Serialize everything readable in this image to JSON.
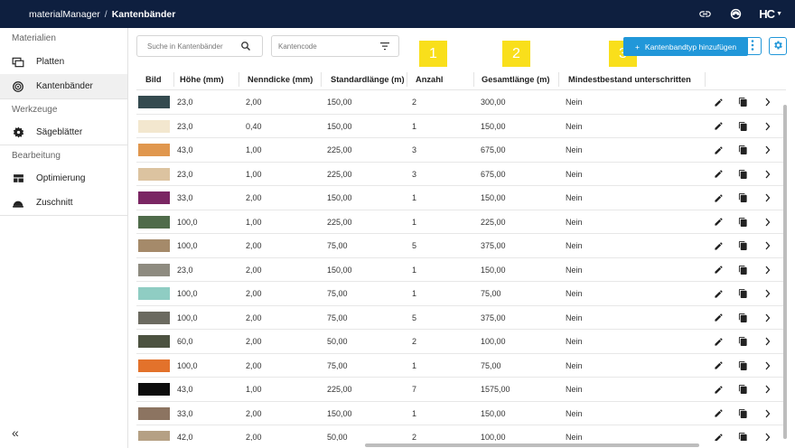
{
  "topbar": {
    "app": "materialManager",
    "separator": "/",
    "page": "Kantenbänder",
    "brand": "HC",
    "icons": [
      "link-icon",
      "support-icon",
      "brand-logo",
      "caret-down-icon"
    ]
  },
  "sidebar": {
    "sections": [
      {
        "title": "Materialien",
        "items": [
          {
            "label": "Platten",
            "icon": "platten-icon"
          },
          {
            "label": "Kantenbänder",
            "icon": "edgeband-roll-icon",
            "active": true
          }
        ]
      },
      {
        "title": "Werkzeuge",
        "items": [
          {
            "label": "Sägeblätter",
            "icon": "saw-blade-icon"
          }
        ]
      },
      {
        "title": "Bearbeitung",
        "items": [
          {
            "label": "Optimierung",
            "icon": "optimization-icon"
          },
          {
            "label": "Zuschnitt",
            "icon": "cutting-icon"
          }
        ]
      }
    ],
    "collapse": "«"
  },
  "toolbar": {
    "search_placeholder": "Suche in Kantenbänder",
    "filter_placeholder": "Kantencode",
    "add_label": "Kantenbandtyp hinzufügen",
    "add_plus": "+"
  },
  "markers": [
    "1",
    "2",
    "3"
  ],
  "colors": {
    "topbar": "#0e1f3f",
    "accent": "#2197d9",
    "marker": "#f9df1b"
  },
  "table": {
    "headers": [
      "Bild",
      "Höhe (mm)",
      "Nenndicke (mm)",
      "Standardlänge (m)",
      "Anzahl",
      "Gesamtlänge (m)",
      "Mindestbestand unterschritten"
    ],
    "rows": [
      {
        "color": "#344a4f",
        "hoehe": "23,0",
        "dicke": "2,00",
        "laenge": "150,00",
        "anzahl": "2",
        "gesamt": "300,00",
        "mindest": "Nein"
      },
      {
        "color": "#f3e7cf",
        "hoehe": "23,0",
        "dicke": "0,40",
        "laenge": "150,00",
        "anzahl": "1",
        "gesamt": "150,00",
        "mindest": "Nein"
      },
      {
        "color": "#e0974e",
        "hoehe": "43,0",
        "dicke": "1,00",
        "laenge": "225,00",
        "anzahl": "3",
        "gesamt": "675,00",
        "mindest": "Nein"
      },
      {
        "color": "#dcc3a0",
        "hoehe": "23,0",
        "dicke": "1,00",
        "laenge": "225,00",
        "anzahl": "3",
        "gesamt": "675,00",
        "mindest": "Nein"
      },
      {
        "color": "#7a2663",
        "hoehe": "33,0",
        "dicke": "2,00",
        "laenge": "150,00",
        "anzahl": "1",
        "gesamt": "150,00",
        "mindest": "Nein"
      },
      {
        "color": "#4f6b4a",
        "hoehe": "100,0",
        "dicke": "1,00",
        "laenge": "225,00",
        "anzahl": "1",
        "gesamt": "225,00",
        "mindest": "Nein"
      },
      {
        "color": "#a58a6a",
        "hoehe": "100,0",
        "dicke": "2,00",
        "laenge": "75,00",
        "anzahl": "5",
        "gesamt": "375,00",
        "mindest": "Nein"
      },
      {
        "color": "#8e8b80",
        "hoehe": "23,0",
        "dicke": "2,00",
        "laenge": "150,00",
        "anzahl": "1",
        "gesamt": "150,00",
        "mindest": "Nein"
      },
      {
        "color": "#8fcdc3",
        "hoehe": "100,0",
        "dicke": "2,00",
        "laenge": "75,00",
        "anzahl": "1",
        "gesamt": "75,00",
        "mindest": "Nein"
      },
      {
        "color": "#6b6a60",
        "hoehe": "100,0",
        "dicke": "2,00",
        "laenge": "75,00",
        "anzahl": "5",
        "gesamt": "375,00",
        "mindest": "Nein"
      },
      {
        "color": "#4c5240",
        "hoehe": "60,0",
        "dicke": "2,00",
        "laenge": "50,00",
        "anzahl": "2",
        "gesamt": "100,00",
        "mindest": "Nein"
      },
      {
        "color": "#e3722b",
        "hoehe": "100,0",
        "dicke": "2,00",
        "laenge": "75,00",
        "anzahl": "1",
        "gesamt": "75,00",
        "mindest": "Nein"
      },
      {
        "color": "#0d0d0d",
        "hoehe": "43,0",
        "dicke": "1,00",
        "laenge": "225,00",
        "anzahl": "7",
        "gesamt": "1575,00",
        "mindest": "Nein"
      },
      {
        "color": "#8c7461",
        "hoehe": "33,0",
        "dicke": "2,00",
        "laenge": "150,00",
        "anzahl": "1",
        "gesamt": "150,00",
        "mindest": "Nein"
      },
      {
        "color": "#b5a084",
        "hoehe": "42,0",
        "dicke": "2,00",
        "laenge": "50,00",
        "anzahl": "2",
        "gesamt": "100,00",
        "mindest": "Nein"
      }
    ]
  }
}
